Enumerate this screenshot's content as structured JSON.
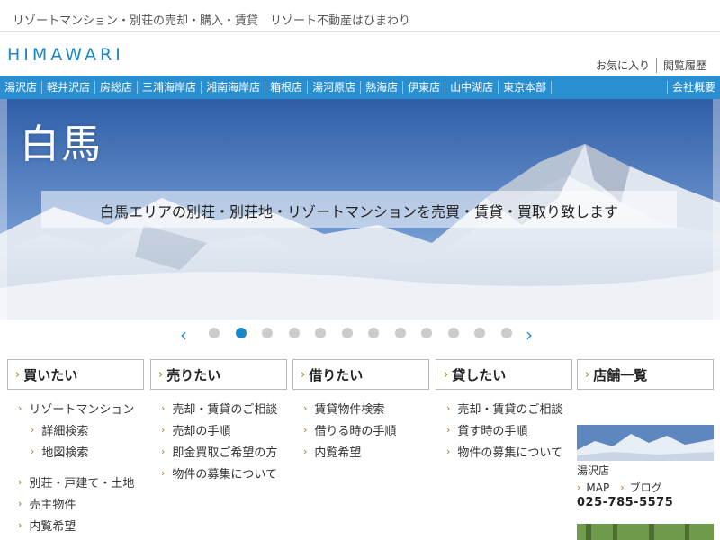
{
  "tagline": "リゾートマンション・別荘の売却・購入・賃貸　リゾート不動産はひまわり",
  "logo": "HIMAWARI",
  "util_links": [
    "お気に入り",
    "閲覧履歴"
  ],
  "nav": {
    "stores": [
      "湯沢店",
      "軽井沢店",
      "房総店",
      "三浦海岸店",
      "湘南海岸店",
      "箱根店",
      "湯河原店",
      "熱海店",
      "伊東店",
      "山中湖店",
      "東京本部"
    ],
    "company": "会社概要"
  },
  "hero": {
    "title": "白馬",
    "caption": "白馬エリアの別荘・別荘地・リゾートマンションを売買・賃貸・買取り致します"
  },
  "slider": {
    "prev_icon": "chevron-left-icon",
    "next_icon": "chevron-right-icon",
    "dot_count": 12,
    "active_index": 1
  },
  "columns": [
    {
      "title": "買いたい",
      "items": [
        {
          "label": "リゾートマンション",
          "level": 0
        },
        {
          "label": "詳細検索",
          "level": 1
        },
        {
          "label": "地図検索",
          "level": 1
        },
        {
          "label": "別荘・戸建て・土地",
          "level": 0,
          "gap": true
        },
        {
          "label": "売主物件",
          "level": 0
        },
        {
          "label": "内覧希望",
          "level": 0
        }
      ]
    },
    {
      "title": "売りたい",
      "items": [
        {
          "label": "売却・賃貸のご相談",
          "level": 0
        },
        {
          "label": "売却の手順",
          "level": 0
        },
        {
          "label": "即金買取ご希望の方",
          "level": 0
        },
        {
          "label": "物件の募集について",
          "level": 0
        }
      ]
    },
    {
      "title": "借りたい",
      "items": [
        {
          "label": "賃貸物件検索",
          "level": 0
        },
        {
          "label": "借りる時の手順",
          "level": 0
        },
        {
          "label": "内覧希望",
          "level": 0
        }
      ]
    },
    {
      "title": "貸したい",
      "items": [
        {
          "label": "売却・賃貸のご相談",
          "level": 0
        },
        {
          "label": "貸す時の手順",
          "level": 0
        },
        {
          "label": "物件の募集について",
          "level": 0
        }
      ]
    },
    {
      "title": "店舗一覧",
      "items": []
    }
  ],
  "store": {
    "name": "湯沢店",
    "map_label": "MAP",
    "blog_label": "ブログ",
    "phone": "025-785-5575"
  },
  "colors": {
    "accent": "#2a8fd1",
    "logo": "#1e88c7",
    "chevron": "#a0762b"
  }
}
